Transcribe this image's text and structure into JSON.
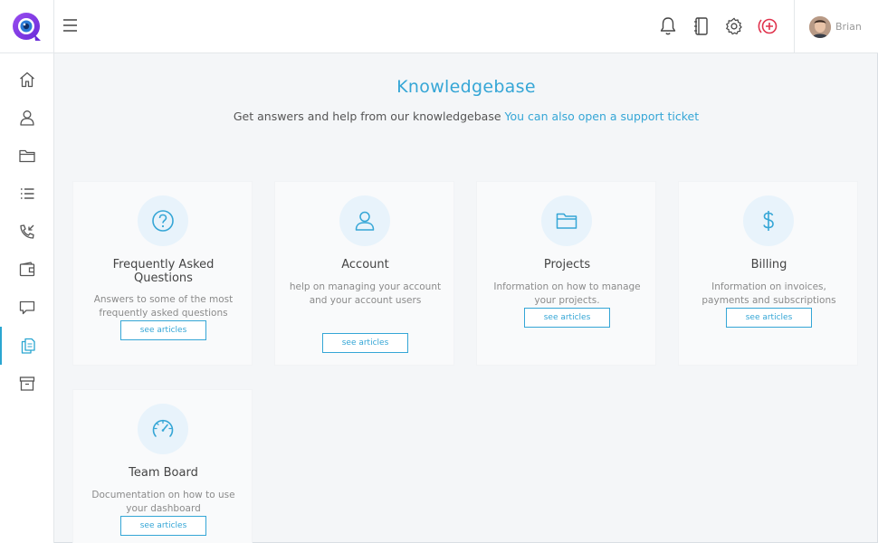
{
  "app": {
    "brand_color": "#7b3fe4",
    "accent_color": "#35a6d6",
    "alert_color": "#e0334d"
  },
  "header": {
    "menu_icon": "hamburger-icon",
    "icons": [
      "bell-icon",
      "notebook-icon",
      "gear-icon",
      "add-circle-icon"
    ],
    "user": {
      "name": "Brian"
    }
  },
  "sidebar": {
    "items": [
      {
        "icon": "home-icon"
      },
      {
        "icon": "user-icon"
      },
      {
        "icon": "folder-icon"
      },
      {
        "icon": "list-icon"
      },
      {
        "icon": "phone-icon"
      },
      {
        "icon": "wallet-icon"
      },
      {
        "icon": "chat-icon"
      },
      {
        "icon": "documents-icon",
        "active": true
      },
      {
        "icon": "archive-icon"
      }
    ]
  },
  "main": {
    "title": "Knowledgebase",
    "subtitle": "Get answers and help from our knowledgebase",
    "subtitle_link": "You can also open a support ticket",
    "cards": [
      {
        "icon": "question-icon",
        "title": "Frequently Asked Questions",
        "description": "Answers to some of the most frequently asked questions",
        "button": "see articles"
      },
      {
        "icon": "user-icon",
        "title": "Account",
        "description": "help on managing your account and your account users",
        "button": "see articles"
      },
      {
        "icon": "folder-icon",
        "title": "Projects",
        "description": "Information on how to manage your projects.",
        "button": "see articles"
      },
      {
        "icon": "dollar-icon",
        "title": "Billing",
        "description": "Information on invoices, payments and subscriptions",
        "button": "see articles"
      },
      {
        "icon": "speedometer-icon",
        "title": "Team Board",
        "description": "Documentation on how to use your dashboard",
        "button": "see articles"
      }
    ]
  }
}
